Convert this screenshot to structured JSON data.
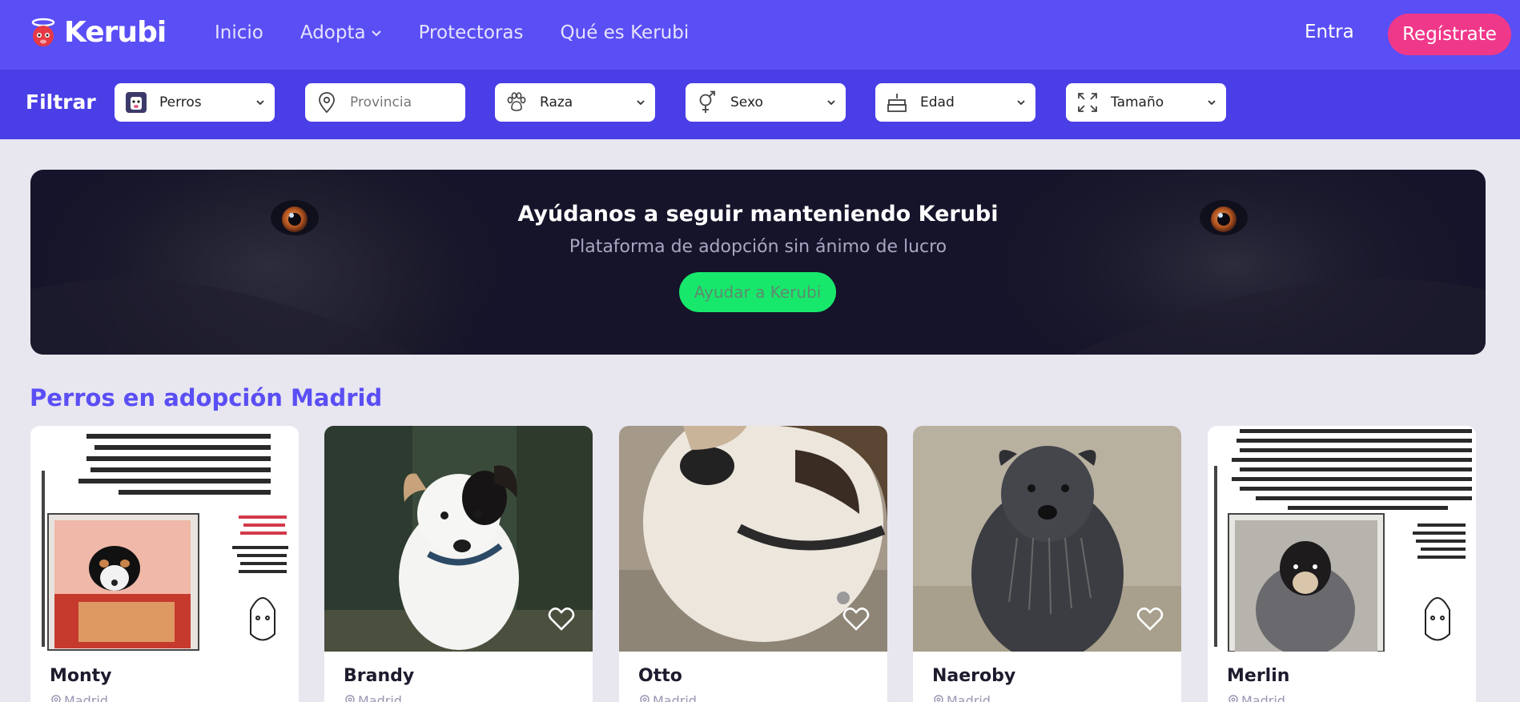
{
  "header": {
    "logo_text": "Kerubi",
    "nav": [
      {
        "label": "Inicio"
      },
      {
        "label": "Adopta"
      },
      {
        "label": "Protectoras"
      },
      {
        "label": "Qué es Kerubi"
      }
    ],
    "login_label": "Entra",
    "register_label": "Regístrate"
  },
  "filters": {
    "title": "Filtrar",
    "items": [
      {
        "icon": "dog-face-icon",
        "label": "Perros"
      },
      {
        "icon": "location-pin-icon",
        "placeholder": "Provincia"
      },
      {
        "icon": "paw-icon",
        "label": "Raza"
      },
      {
        "icon": "gender-icon",
        "label": "Sexo"
      },
      {
        "icon": "cake-icon",
        "label": "Edad"
      },
      {
        "icon": "expand-icon",
        "label": "Tamaño"
      }
    ]
  },
  "banner": {
    "title": "Ayúdanos a seguir manteniendo Kerubi",
    "subtitle": "Plataforma de adopción sin ánimo de lucro",
    "button_label": "Ayudar a Kerubi"
  },
  "section": {
    "title": "Perros en adopción Madrid"
  },
  "cards": [
    {
      "name": "Monty",
      "location": "Madrid"
    },
    {
      "name": "Brandy",
      "location": "Madrid"
    },
    {
      "name": "Otto",
      "location": "Madrid"
    },
    {
      "name": "Naeroby",
      "location": "Madrid"
    },
    {
      "name": "Merlin",
      "location": "Madrid"
    }
  ],
  "colors": {
    "primary": "#5a4ef5",
    "filterbar": "#4a3ee6",
    "register": "#f0388a",
    "cta": "#17e86b"
  }
}
